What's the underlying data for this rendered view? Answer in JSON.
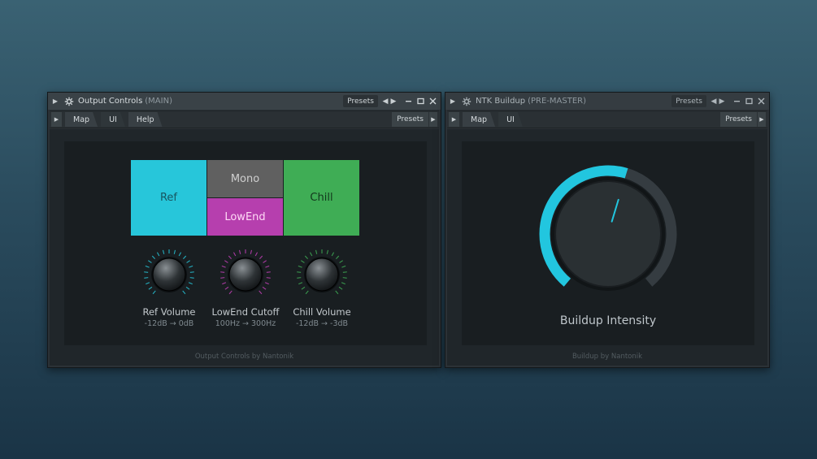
{
  "windows": {
    "output": {
      "title": "Output Controls",
      "subtitle": "(MAIN)",
      "presets_label": "Presets",
      "tabs": [
        {
          "label": "Map"
        },
        {
          "label": "UI"
        },
        {
          "label": "Help"
        }
      ],
      "toolbar_presets": "Presets",
      "pads": {
        "ref": "Ref",
        "mono": "Mono",
        "lowend": "LowEnd",
        "chill": "Chill"
      },
      "knobs": [
        {
          "label": "Ref Volume",
          "range": "-12dB → 0dB",
          "color": "#27c6da"
        },
        {
          "label": "LowEnd Cutoff",
          "range": "100Hz → 300Hz",
          "color": "#c33fb8"
        },
        {
          "label": "Chill Volume",
          "range": "-12dB → -3dB",
          "color": "#3fad55"
        }
      ],
      "footer": "Output Controls by Nantonik"
    },
    "buildup": {
      "title": "NTK Buildup",
      "subtitle": "(PRE-MASTER)",
      "presets_label": "Presets",
      "tabs": [
        {
          "label": "Map"
        },
        {
          "label": "UI"
        }
      ],
      "toolbar_presets": "Presets",
      "knob_label": "Buildup Intensity",
      "knob_value": 0.56,
      "knob_color": "#22c6df",
      "footer": "Buildup by Nantonik"
    }
  },
  "icons": {
    "gear": "gear-icon",
    "minimize": "minimize-icon",
    "maximize": "maximize-icon",
    "close": "close-icon"
  }
}
